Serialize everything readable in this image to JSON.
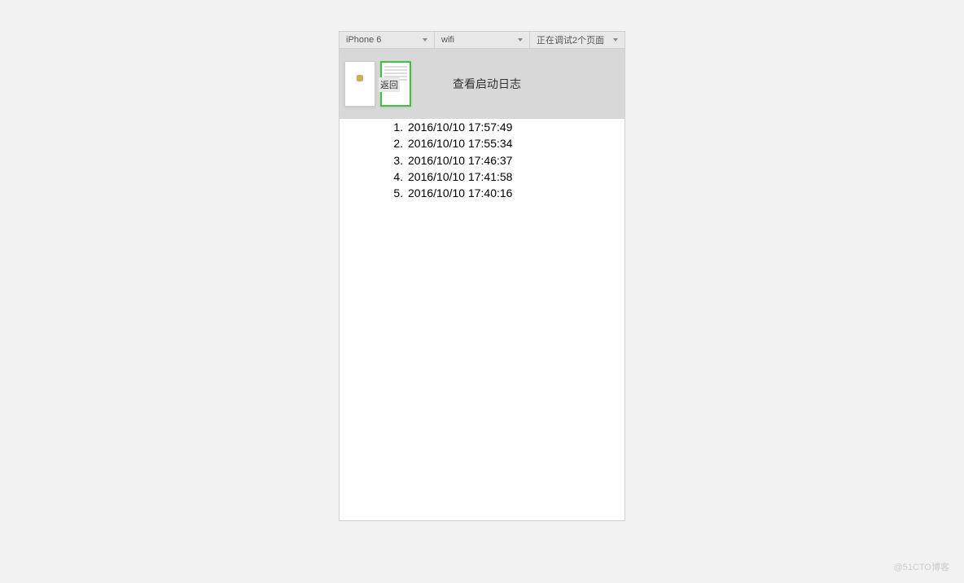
{
  "toolbar": {
    "device": "iPhone 6",
    "network": "wifi",
    "debug_status": "正在调试2个页面"
  },
  "preview": {
    "back_label": "返回",
    "page_title": "查看启动日志"
  },
  "logs": [
    "2016/10/10 17:57:49",
    "2016/10/10 17:55:34",
    "2016/10/10 17:46:37",
    "2016/10/10 17:41:58",
    "2016/10/10 17:40:16"
  ],
  "watermark": "@51CTO博客"
}
